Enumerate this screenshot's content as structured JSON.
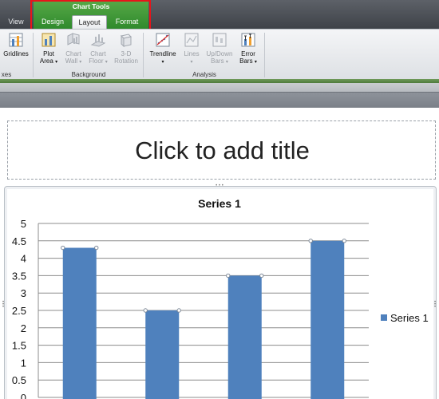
{
  "tabs": {
    "view": "View",
    "design": "Design",
    "layout": "Layout",
    "format": "Format",
    "context_group": "Chart Tools"
  },
  "ribbon": {
    "gridlines": {
      "line1": "Gridlines",
      "line2": ""
    },
    "axes_group_fragment": "xes",
    "plot_area": {
      "line1": "Plot",
      "line2": "Area"
    },
    "chart_wall": {
      "line1": "Chart",
      "line2": "Wall"
    },
    "chart_floor": {
      "line1": "Chart",
      "line2": "Floor"
    },
    "rotation_3d": {
      "line1": "3-D",
      "line2": "Rotation"
    },
    "background_group": "Background",
    "trendline": {
      "line1": "Trendline",
      "line2": ""
    },
    "lines": {
      "line1": "Lines",
      "line2": ""
    },
    "updown_bars": {
      "line1": "Up/Down",
      "line2": "Bars"
    },
    "error_bars": {
      "line1": "Error",
      "line2": "Bars"
    },
    "analysis_group": "Analysis",
    "arrow": "▾"
  },
  "slide": {
    "title_placeholder": "Click to add title"
  },
  "colors": {
    "bar": "#4f81bd",
    "context_green": "#3b9a36",
    "highlight_red": "#e8141a"
  },
  "chart_data": {
    "type": "bar",
    "title": "Series 1",
    "categories": [
      "",
      "",
      "",
      ""
    ],
    "series": [
      {
        "name": "Series 1",
        "values": [
          4.3,
          2.5,
          3.5,
          4.5
        ]
      }
    ],
    "ylim": [
      0,
      5
    ],
    "yticks": [
      "0",
      "0.5",
      "1",
      "1.5",
      "2",
      "2.5",
      "3",
      "3.5",
      "4",
      "4.5",
      "5"
    ],
    "grid": true,
    "legend": "right",
    "xlabel": "",
    "ylabel": ""
  }
}
